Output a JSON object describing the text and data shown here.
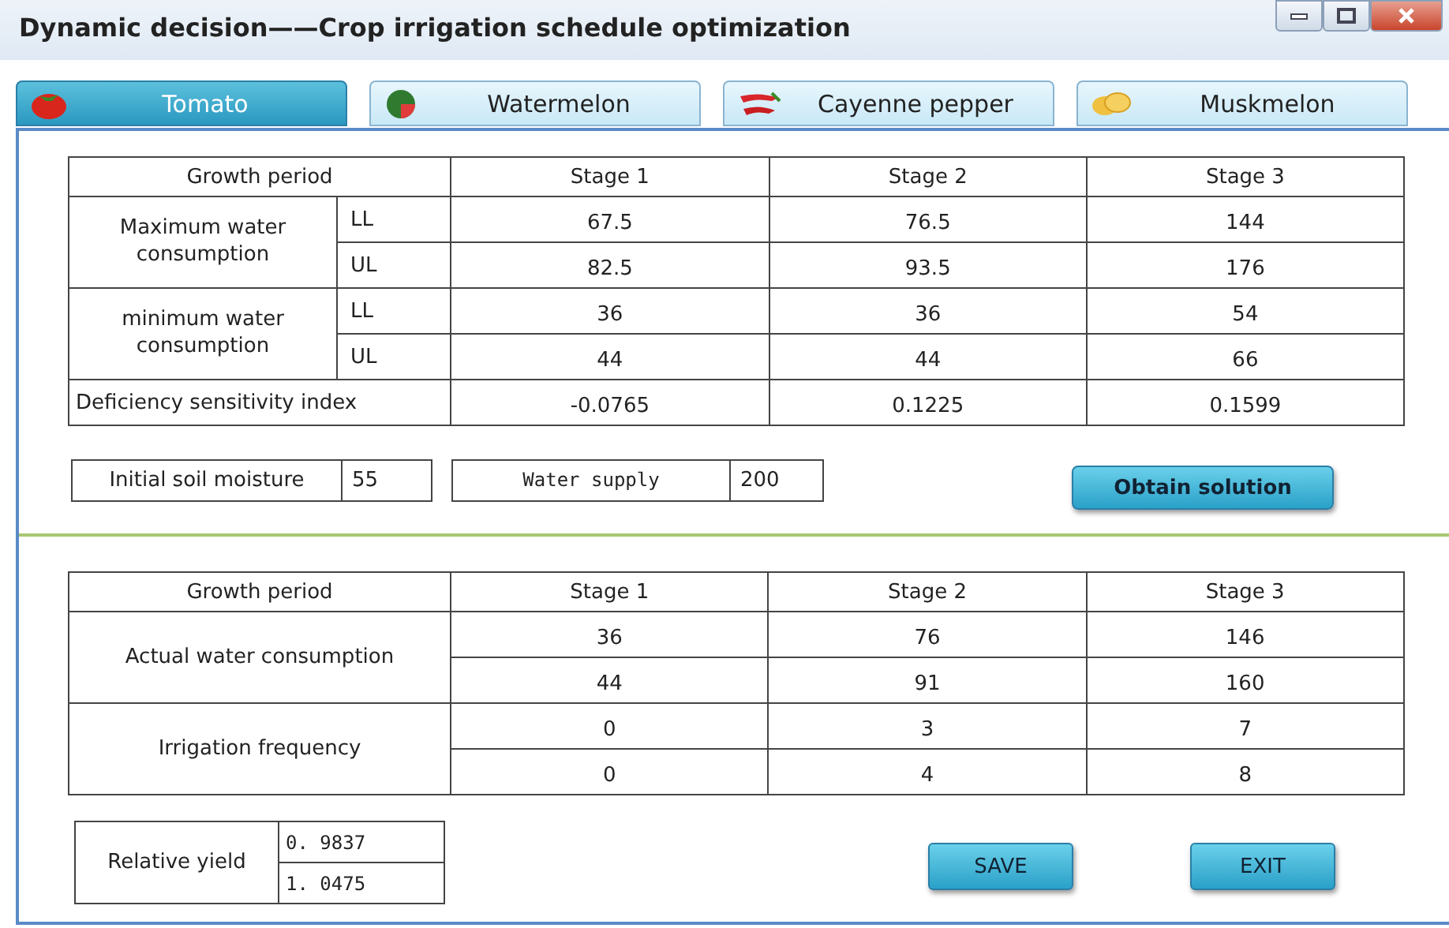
{
  "window": {
    "title": "Dynamic decision——Crop irrigation schedule optimization"
  },
  "tabs": [
    {
      "label": "Tomato",
      "kind": "tomato",
      "selected": true
    },
    {
      "label": "Watermelon",
      "kind": "watermelon",
      "selected": false
    },
    {
      "label": "Cayenne pepper",
      "kind": "pepper",
      "selected": false
    },
    {
      "label": "Muskmelon",
      "kind": "muskmelon",
      "selected": false
    }
  ],
  "parameters_table": {
    "header": [
      "Growth period",
      "Stage 1",
      "Stage 2",
      "Stage 3"
    ],
    "groups": [
      {
        "label": "Maximum water consumption",
        "rows": [
          {
            "limit": "LL",
            "values": [
              "67.5",
              "76.5",
              "144"
            ]
          },
          {
            "limit": "UL",
            "values": [
              "82.5",
              "93.5",
              "176"
            ]
          }
        ]
      },
      {
        "label": "minimum water consumption",
        "rows": [
          {
            "limit": "LL",
            "values": [
              "36",
              "36",
              "54"
            ]
          },
          {
            "limit": "UL",
            "values": [
              "44",
              "44",
              "66"
            ]
          }
        ]
      }
    ],
    "index_row": {
      "label": "Deficiency sensitivity index",
      "values": [
        "-0.0765",
        "0.1225",
        "0.1599"
      ]
    }
  },
  "initial_soil_moisture": {
    "label": "Initial soil moisture",
    "value": "55"
  },
  "water_supply": {
    "label": "Water supply",
    "value": "200"
  },
  "obtain_button": "Obtain  solution",
  "results_table": {
    "header": [
      "Growth period",
      "Stage 1",
      "Stage 2",
      "Stage 3"
    ],
    "groups": [
      {
        "label": "Actual water consumption",
        "rows": [
          [
            "36",
            "76",
            "146"
          ],
          [
            "44",
            "91",
            "160"
          ]
        ]
      },
      {
        "label": "Irrigation frequency",
        "rows": [
          [
            "0",
            "3",
            "7"
          ],
          [
            "0",
            "4",
            "8"
          ]
        ]
      }
    ]
  },
  "relative_yield": {
    "label": "Relative yield",
    "values": [
      "0. 9837",
      "1. 0475"
    ]
  },
  "buttons": [
    "SAVE",
    "EXIT"
  ]
}
